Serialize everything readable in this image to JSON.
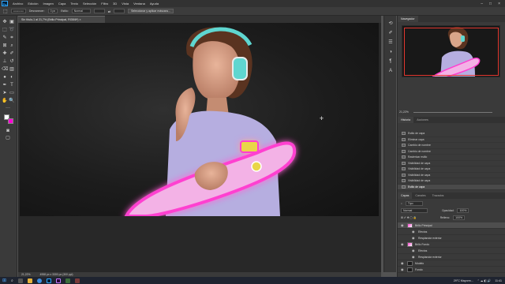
{
  "app": {
    "logo": "Ps"
  },
  "menu": [
    "Archivo",
    "Edición",
    "Imagen",
    "Capa",
    "Texto",
    "Selección",
    "Filtro",
    "3D",
    "Vista",
    "Ventana",
    "Ayuda"
  ],
  "options": {
    "feather_label": "Desvanecer:",
    "feather_value": "0 px",
    "style_label": "Estilo:",
    "style_value": "Normal",
    "select_button": "Seleccionar y aplicar máscara..."
  },
  "document": {
    "tab_title": "Sin título-1 al 21,7% (Brillo Principal, RGB/8*) ×",
    "zoom": "21,22%",
    "size_info": "4958 px x 3300 px (300 ppi)"
  },
  "panels": {
    "navigator_tab": "Navegador",
    "nav_zoom": "21,22%",
    "history_tabs": [
      "Historia",
      "Acciones"
    ],
    "history_items": [
      "Estilo de capa",
      "Eliminar capa",
      "Cambio de nombre",
      "Cambio de nombre",
      "Rasterizar estilo",
      "Visibilidad de capa",
      "Visibilidad de capa",
      "Visibilidad de capa",
      "Visibilidad de capa",
      "Estilo de capa"
    ],
    "layers_tabs": [
      "Capas",
      "Canales",
      "Trazados"
    ],
    "layers_filter": "Tipo",
    "blend_mode": "Normal",
    "opacity_label": "Opacidad:",
    "opacity_value": "100%",
    "fill_label": "Relleno:",
    "fill_value": "100%",
    "layers": [
      {
        "name": "Brillo Principal",
        "indent": false,
        "selected": true
      },
      {
        "name": "Efectos",
        "indent": true,
        "selected": false
      },
      {
        "name": "Resplandor exterior",
        "indent": true,
        "selected": false
      },
      {
        "name": "Brillo Fondo",
        "indent": false,
        "selected": false
      },
      {
        "name": "Efectos",
        "indent": true,
        "selected": false
      },
      {
        "name": "Resplandor exterior",
        "indent": true,
        "selected": false
      },
      {
        "name": "Modelo",
        "indent": false,
        "selected": false
      },
      {
        "name": "Fondo",
        "indent": false,
        "selected": false
      }
    ]
  },
  "taskbar": {
    "weather": "29°C  Mayorm...",
    "time": "11:41"
  },
  "colors": {
    "accent_pink": "#ff3fd0",
    "nav_frame": "#e0372f",
    "headphones": "#5fd6d0"
  }
}
